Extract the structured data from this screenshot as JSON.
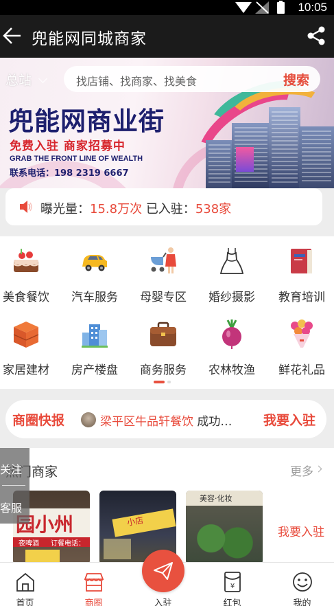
{
  "status_bar": {
    "time": "10:05"
  },
  "nav": {
    "title": "兜能网同城商家"
  },
  "search": {
    "city": "总站",
    "placeholder": "找店铺、找商家、找美食",
    "button": "搜索"
  },
  "banner": {
    "title_part1": "兜能网",
    "title_part2": "商业街",
    "subtitle": "免费入驻 商家招募中",
    "english": "GRAB THE FRONT LINE OF WEALTH",
    "phone": "联系电话：198 2319 6667"
  },
  "stats": {
    "exposure_label": "曝光量：",
    "exposure_value": "15.8万次",
    "joined_label": "已入驻：",
    "joined_value": "538家"
  },
  "categories": [
    {
      "label": "美食餐饮",
      "icon": "cake-icon"
    },
    {
      "label": "汽车服务",
      "icon": "car-icon"
    },
    {
      "label": "母婴专区",
      "icon": "stroller-icon"
    },
    {
      "label": "婚纱摄影",
      "icon": "wedding-dress-icon"
    },
    {
      "label": "教育培训",
      "icon": "book-icon"
    },
    {
      "label": "家居建材",
      "icon": "cabinet-icon"
    },
    {
      "label": "房产楼盘",
      "icon": "building-icon"
    },
    {
      "label": "商务服务",
      "icon": "briefcase-icon"
    },
    {
      "label": "农林牧渔",
      "icon": "radish-icon"
    },
    {
      "label": "鲜花礼品",
      "icon": "bouquet-icon"
    }
  ],
  "news": {
    "label": "商圈快报",
    "shop": "梁平区牛品轩餐饮",
    "text": "成功…",
    "cta": "我要入驻"
  },
  "hot": {
    "title": "热门商家",
    "more": "更多",
    "join": "我要入驻",
    "shops": [
      {
        "sign": "园小州",
        "sub1": "夜啤酒",
        "sub2": "订餐电话："
      },
      {
        "sign": "小店"
      },
      {
        "sign": "美容·化妆"
      }
    ]
  },
  "side": {
    "follow": "关注",
    "service": "客服"
  },
  "tabs": [
    {
      "label": "首页",
      "icon": "home-icon"
    },
    {
      "label": "商圈",
      "icon": "store-icon"
    },
    {
      "label": "入驻",
      "icon": "paper-plane-icon"
    },
    {
      "label": "红包",
      "icon": "red-envelope-icon"
    },
    {
      "label": "我的",
      "icon": "smile-icon"
    }
  ],
  "colors": {
    "accent": "#e84a3b",
    "navbar": "#1b1b1b",
    "banner_title": "#1d1f6e"
  }
}
